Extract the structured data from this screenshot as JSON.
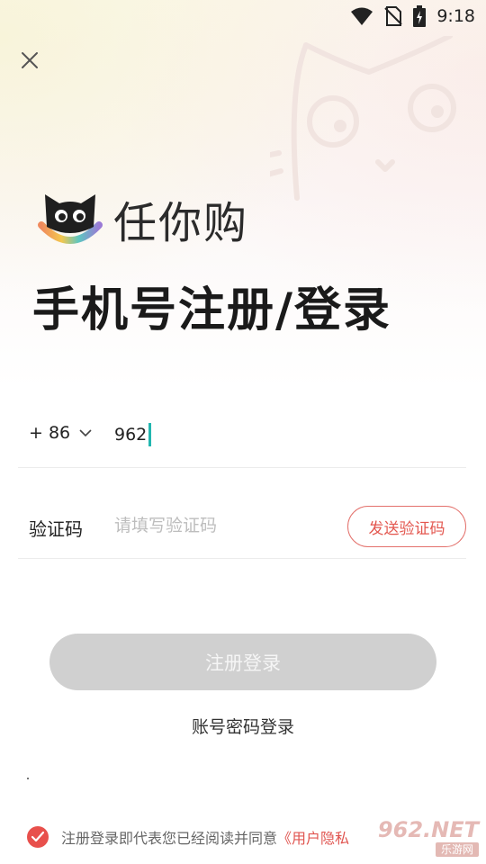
{
  "status_bar": {
    "time": "9:18",
    "icons": [
      "wifi-icon",
      "no-sim-icon",
      "battery-charging-icon"
    ]
  },
  "header": {
    "close_icon": "close-icon"
  },
  "brand": {
    "logo_icon": "cat-logo-icon",
    "name": "任你购"
  },
  "title": "手机号注册/登录",
  "phone": {
    "country_code": "+ 86",
    "value": "962"
  },
  "code": {
    "label": "验证码",
    "placeholder": "请填写验证码",
    "send_button": "发送验证码"
  },
  "submit_button": "注册登录",
  "alt_login": "账号密码登录",
  "agreement": {
    "text": "注册登录即代表您已经阅读并同意",
    "link": "《用户隐私",
    "checked": true
  },
  "watermark": {
    "top": "962.NET",
    "bottom": "乐游网"
  },
  "colors": {
    "accent": "#e3574f",
    "button_disabled": "#d0d0d0",
    "cursor": "#22b6b0"
  }
}
